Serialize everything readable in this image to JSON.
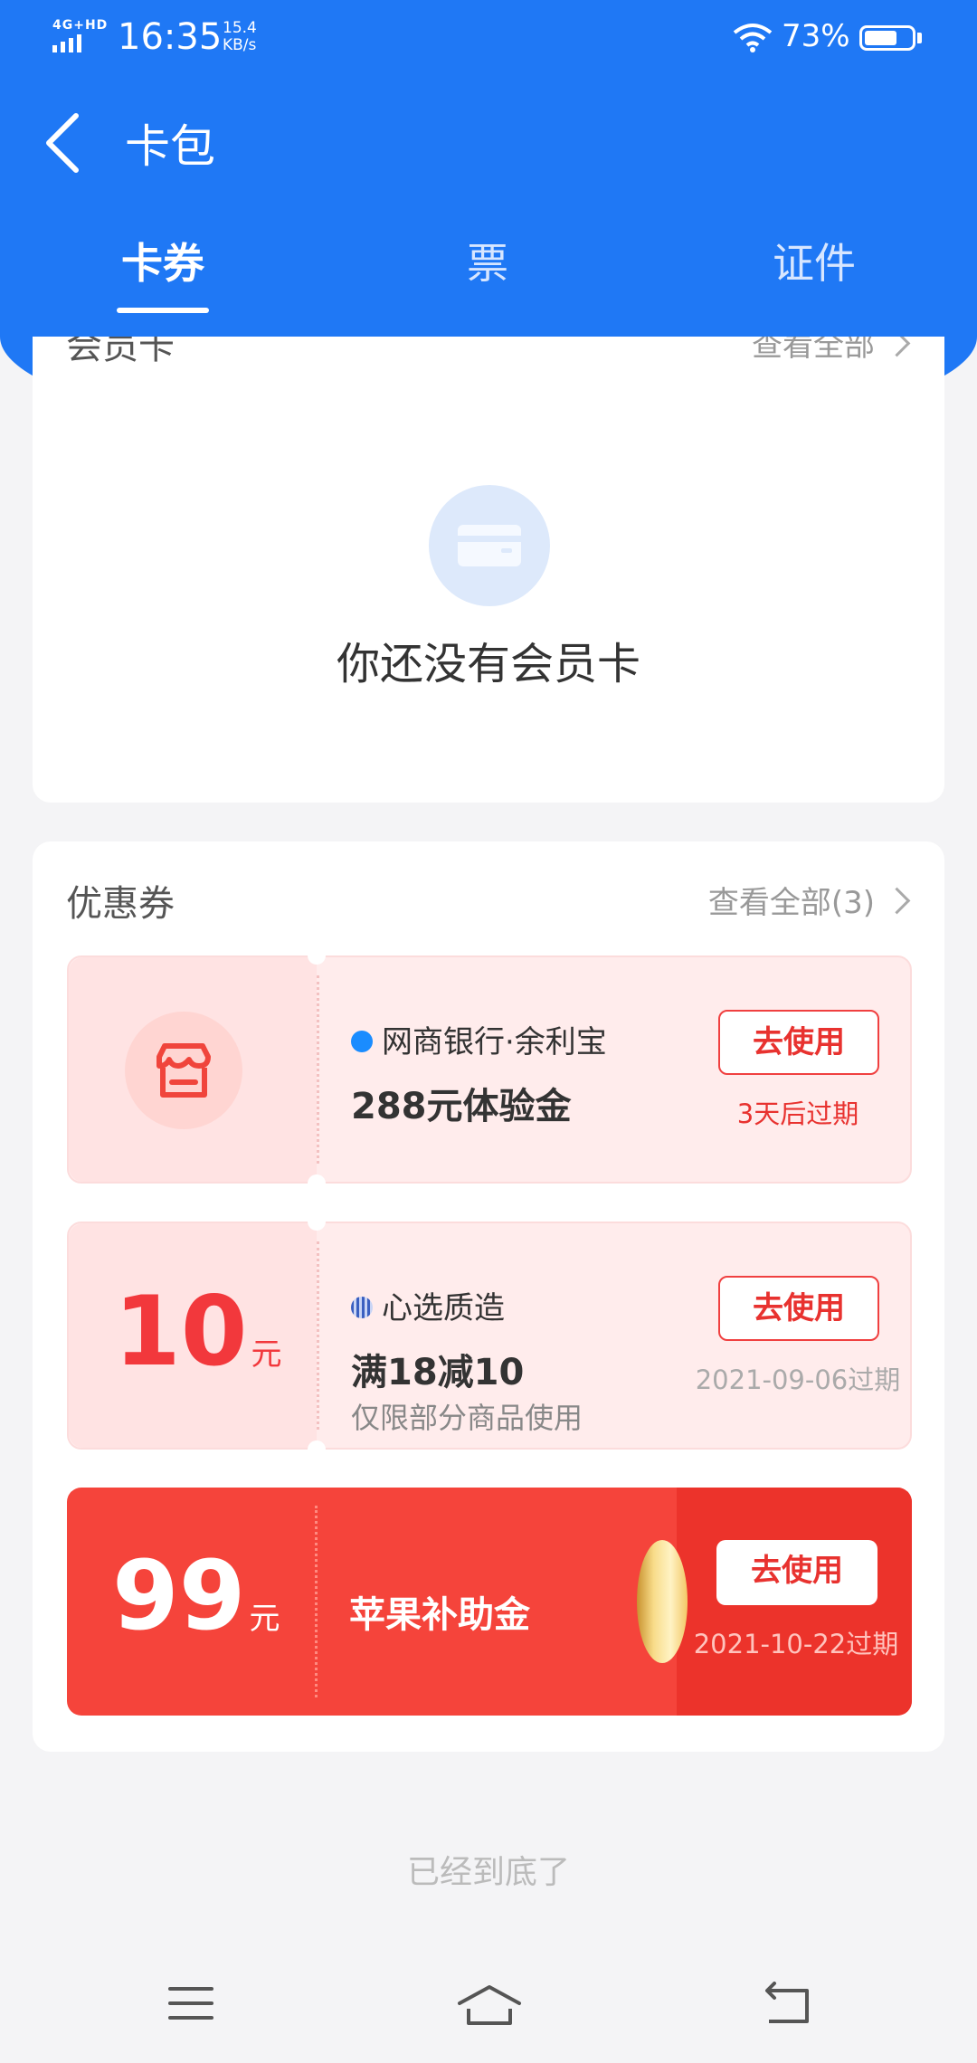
{
  "status": {
    "network": "4G+HD",
    "time": "16:35",
    "speed_value": "15.4",
    "speed_unit": "KB/s",
    "battery": "73%",
    "battery_level": 0.73
  },
  "header": {
    "title": "卡包",
    "tabs": [
      {
        "label": "卡券",
        "active": true
      },
      {
        "label": "票",
        "active": false
      },
      {
        "label": "证件",
        "active": false
      }
    ]
  },
  "member_card": {
    "title": "会员卡",
    "view_all": "查看全部",
    "empty_text": "你还没有会员卡"
  },
  "coupons": {
    "title": "优惠券",
    "view_all": "查看全部(3)",
    "items": [
      {
        "brand": "网商银行·余利宝",
        "title": "288元体验金",
        "button": "去使用",
        "expire": "3天后过期",
        "expire_color": "#e8322f"
      },
      {
        "amount": "10",
        "unit": "元",
        "brand": "心选质造",
        "title": "满18减10",
        "subtitle": "仅限部分商品使用",
        "button": "去使用",
        "expire": "2021-09-06过期"
      },
      {
        "amount": "99",
        "unit": "元",
        "title": "苹果补助金",
        "button": "去使用",
        "expire": "2021-10-22过期"
      }
    ]
  },
  "footer": {
    "end_text": "已经到底了"
  },
  "colors": {
    "primary": "#1f78f5",
    "coupon_red": "#f5443b",
    "accent_red": "#e8322f"
  }
}
